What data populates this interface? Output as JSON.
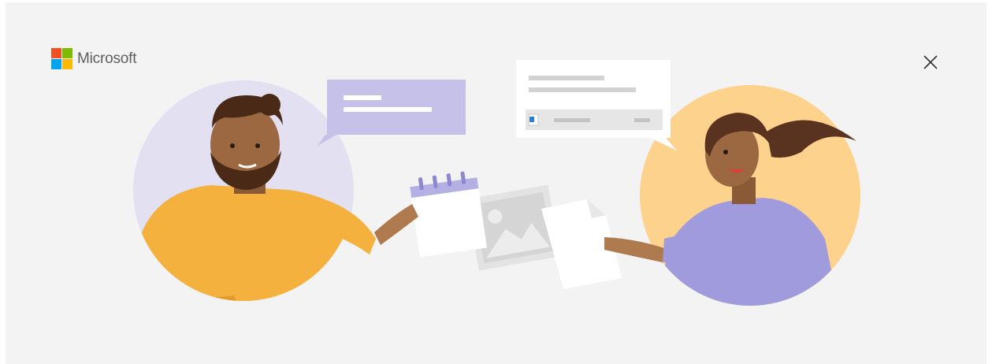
{
  "header": {
    "brand_name": "Microsoft",
    "logo_colors": [
      "#f25022",
      "#7fba00",
      "#00a4ef",
      "#ffb900"
    ]
  },
  "controls": {
    "close_icon": "close-icon"
  },
  "illustration": {
    "description_icons": [
      "person-man-icon",
      "person-woman-icon",
      "chat-bubble-icon",
      "document-card-icon",
      "calendar-icon",
      "image-icon",
      "paper-icon"
    ],
    "colors": {
      "background": "#f3f3f3",
      "left_circle": "#e2e0f1",
      "right_circle": "#fcd28c",
      "orange_shirt": "#f4b13d",
      "purple_shirt": "#9f9bdc",
      "chat_bubble": "#c5c1e8",
      "skin_dark": "#7a4c2c",
      "skin_light": "#b07a4f"
    }
  }
}
